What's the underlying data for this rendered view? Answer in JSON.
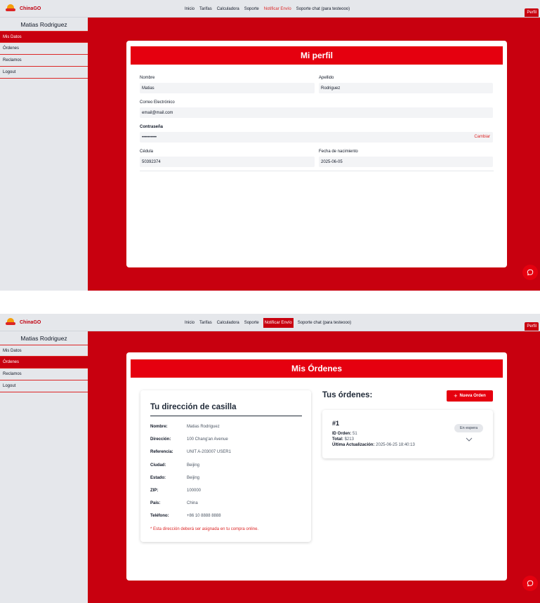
{
  "colors": {
    "brand": "#c8000f",
    "accent": "#e5000f",
    "sidebar": "#e5e7eb",
    "input": "#f3f4f6"
  },
  "brand": {
    "name": "ChinaGO",
    "logo_icon": "chinago-logo-icon"
  },
  "nav": {
    "items": [
      "Inicio",
      "Tarifas",
      "Calculadora",
      "Soporte",
      "Notificar Envío",
      "Soporte chat (para testeooo)"
    ],
    "perfil": "Perfil"
  },
  "sidebar": {
    "user_name": "Matias Rodriguez",
    "items": [
      "Mis Datos",
      "Órdenes",
      "Reclamos",
      "Logout"
    ]
  },
  "profile": {
    "title": "Mi perfil",
    "nombre_label": "Nombre",
    "nombre_value": "Matias",
    "apellido_label": "Apellido",
    "apellido_value": "Rodriguez",
    "email_label": "Correo Electrónico",
    "email_value": "email@mail.com",
    "password_label": "Contraseña",
    "password_value": "••••••••••",
    "change_label": "Cambiar",
    "cedula_label": "Cédula",
    "cedula_value": "50392374",
    "birth_label": "Fecha de nacimiento",
    "birth_value": "2025-06-05"
  },
  "orders_page": {
    "title": "Mis Órdenes",
    "address": {
      "title": "Tu dirección de casilla",
      "rows": [
        {
          "k": "Nombre:",
          "v": "Matias Rodriguez"
        },
        {
          "k": "Dirección:",
          "v": "100 Chang'an Avenue"
        },
        {
          "k": "Referencia:",
          "v": "UNIT A-203007 USER1"
        },
        {
          "k": "Ciudad:",
          "v": "Beijing"
        },
        {
          "k": "Estado:",
          "v": "Beijing"
        },
        {
          "k": "ZIP:",
          "v": "100000"
        },
        {
          "k": "País:",
          "v": "China"
        },
        {
          "k": "Teléfono:",
          "v": "+86 10 8888 8888"
        }
      ],
      "note": "* Esta dirección deberá ser asignada en tu compra online."
    },
    "orders_title": "Tus órdenes:",
    "new_order": "Nueva Orden",
    "order": {
      "number": "#1",
      "id_label": "ID Orden:",
      "id_value": "51",
      "total_label": "Total:",
      "total_value": "$213",
      "updated_label": "Última Actualización:",
      "updated_value": "2025-06-25 18:40:13",
      "status": "En espera"
    }
  }
}
